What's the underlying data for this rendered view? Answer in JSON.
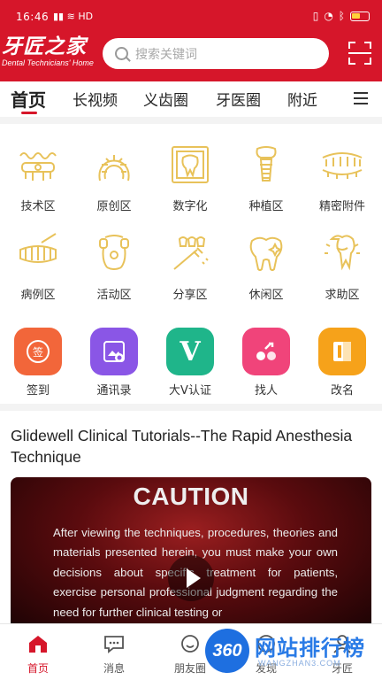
{
  "status_bar": {
    "time": "16:46",
    "network": "HD"
  },
  "logo": {
    "cn": "牙匠之家",
    "en": "Dental Technicians' Home"
  },
  "search": {
    "placeholder": "搜索关键词"
  },
  "tabs": [
    {
      "label": "首页",
      "active": true
    },
    {
      "label": "长视频"
    },
    {
      "label": "义齿圈"
    },
    {
      "label": "牙医圈"
    },
    {
      "label": "附近"
    }
  ],
  "categories": [
    {
      "label": "技术区",
      "icon": "bridge-teeth-icon"
    },
    {
      "label": "原创区",
      "icon": "dental-arch-icon"
    },
    {
      "label": "数字化",
      "icon": "tooth-scan-icon"
    },
    {
      "label": "种植区",
      "icon": "dental-implant-icon"
    },
    {
      "label": "精密附件",
      "icon": "denture-attachment-icon"
    },
    {
      "label": "病例区",
      "icon": "teeth-case-icon"
    },
    {
      "label": "活动区",
      "icon": "partial-denture-icon"
    },
    {
      "label": "分享区",
      "icon": "toothbrush-icon"
    },
    {
      "label": "休闲区",
      "icon": "sparkle-tooth-icon"
    },
    {
      "label": "求助区",
      "icon": "tooth-root-icon"
    }
  ],
  "apps": [
    {
      "label": "签到",
      "icon": "sign-in-icon",
      "color": "#f2663a",
      "glyph": "签"
    },
    {
      "label": "通讯录",
      "icon": "contacts-icon",
      "color": "#8a56e6"
    },
    {
      "label": "大V认证",
      "icon": "verified-v-icon",
      "color": "#1fb58a",
      "glyph": "V"
    },
    {
      "label": "找人",
      "icon": "find-people-icon",
      "color": "#f0447a"
    },
    {
      "label": "改名",
      "icon": "rename-icon",
      "color": "#f6a21a"
    }
  ],
  "article": {
    "title": "Glidewell Clinical Tutorials--The Rapid Anesthesia Technique",
    "video_caption": "CAUTION",
    "video_text": "After viewing the techniques, procedures, theories and materials presented herein, you must make your own decisions about specific treatment for patients, exercise personal professional judgment regarding the need for further clinical testing or"
  },
  "bottom_nav": [
    {
      "label": "首页",
      "icon": "home-icon",
      "active": true
    },
    {
      "label": "消息",
      "icon": "message-icon"
    },
    {
      "label": "朋友圈",
      "icon": "moments-icon"
    },
    {
      "label": "发现",
      "icon": "discover-icon"
    },
    {
      "label": "牙匠",
      "icon": "profile-icon"
    }
  ],
  "watermark": {
    "badge": "360",
    "title": "网站排行榜",
    "url": "WANGZHAN3.COM"
  },
  "colors": {
    "brand_red": "#d6162a",
    "icon_gold": "#e8c25a"
  }
}
